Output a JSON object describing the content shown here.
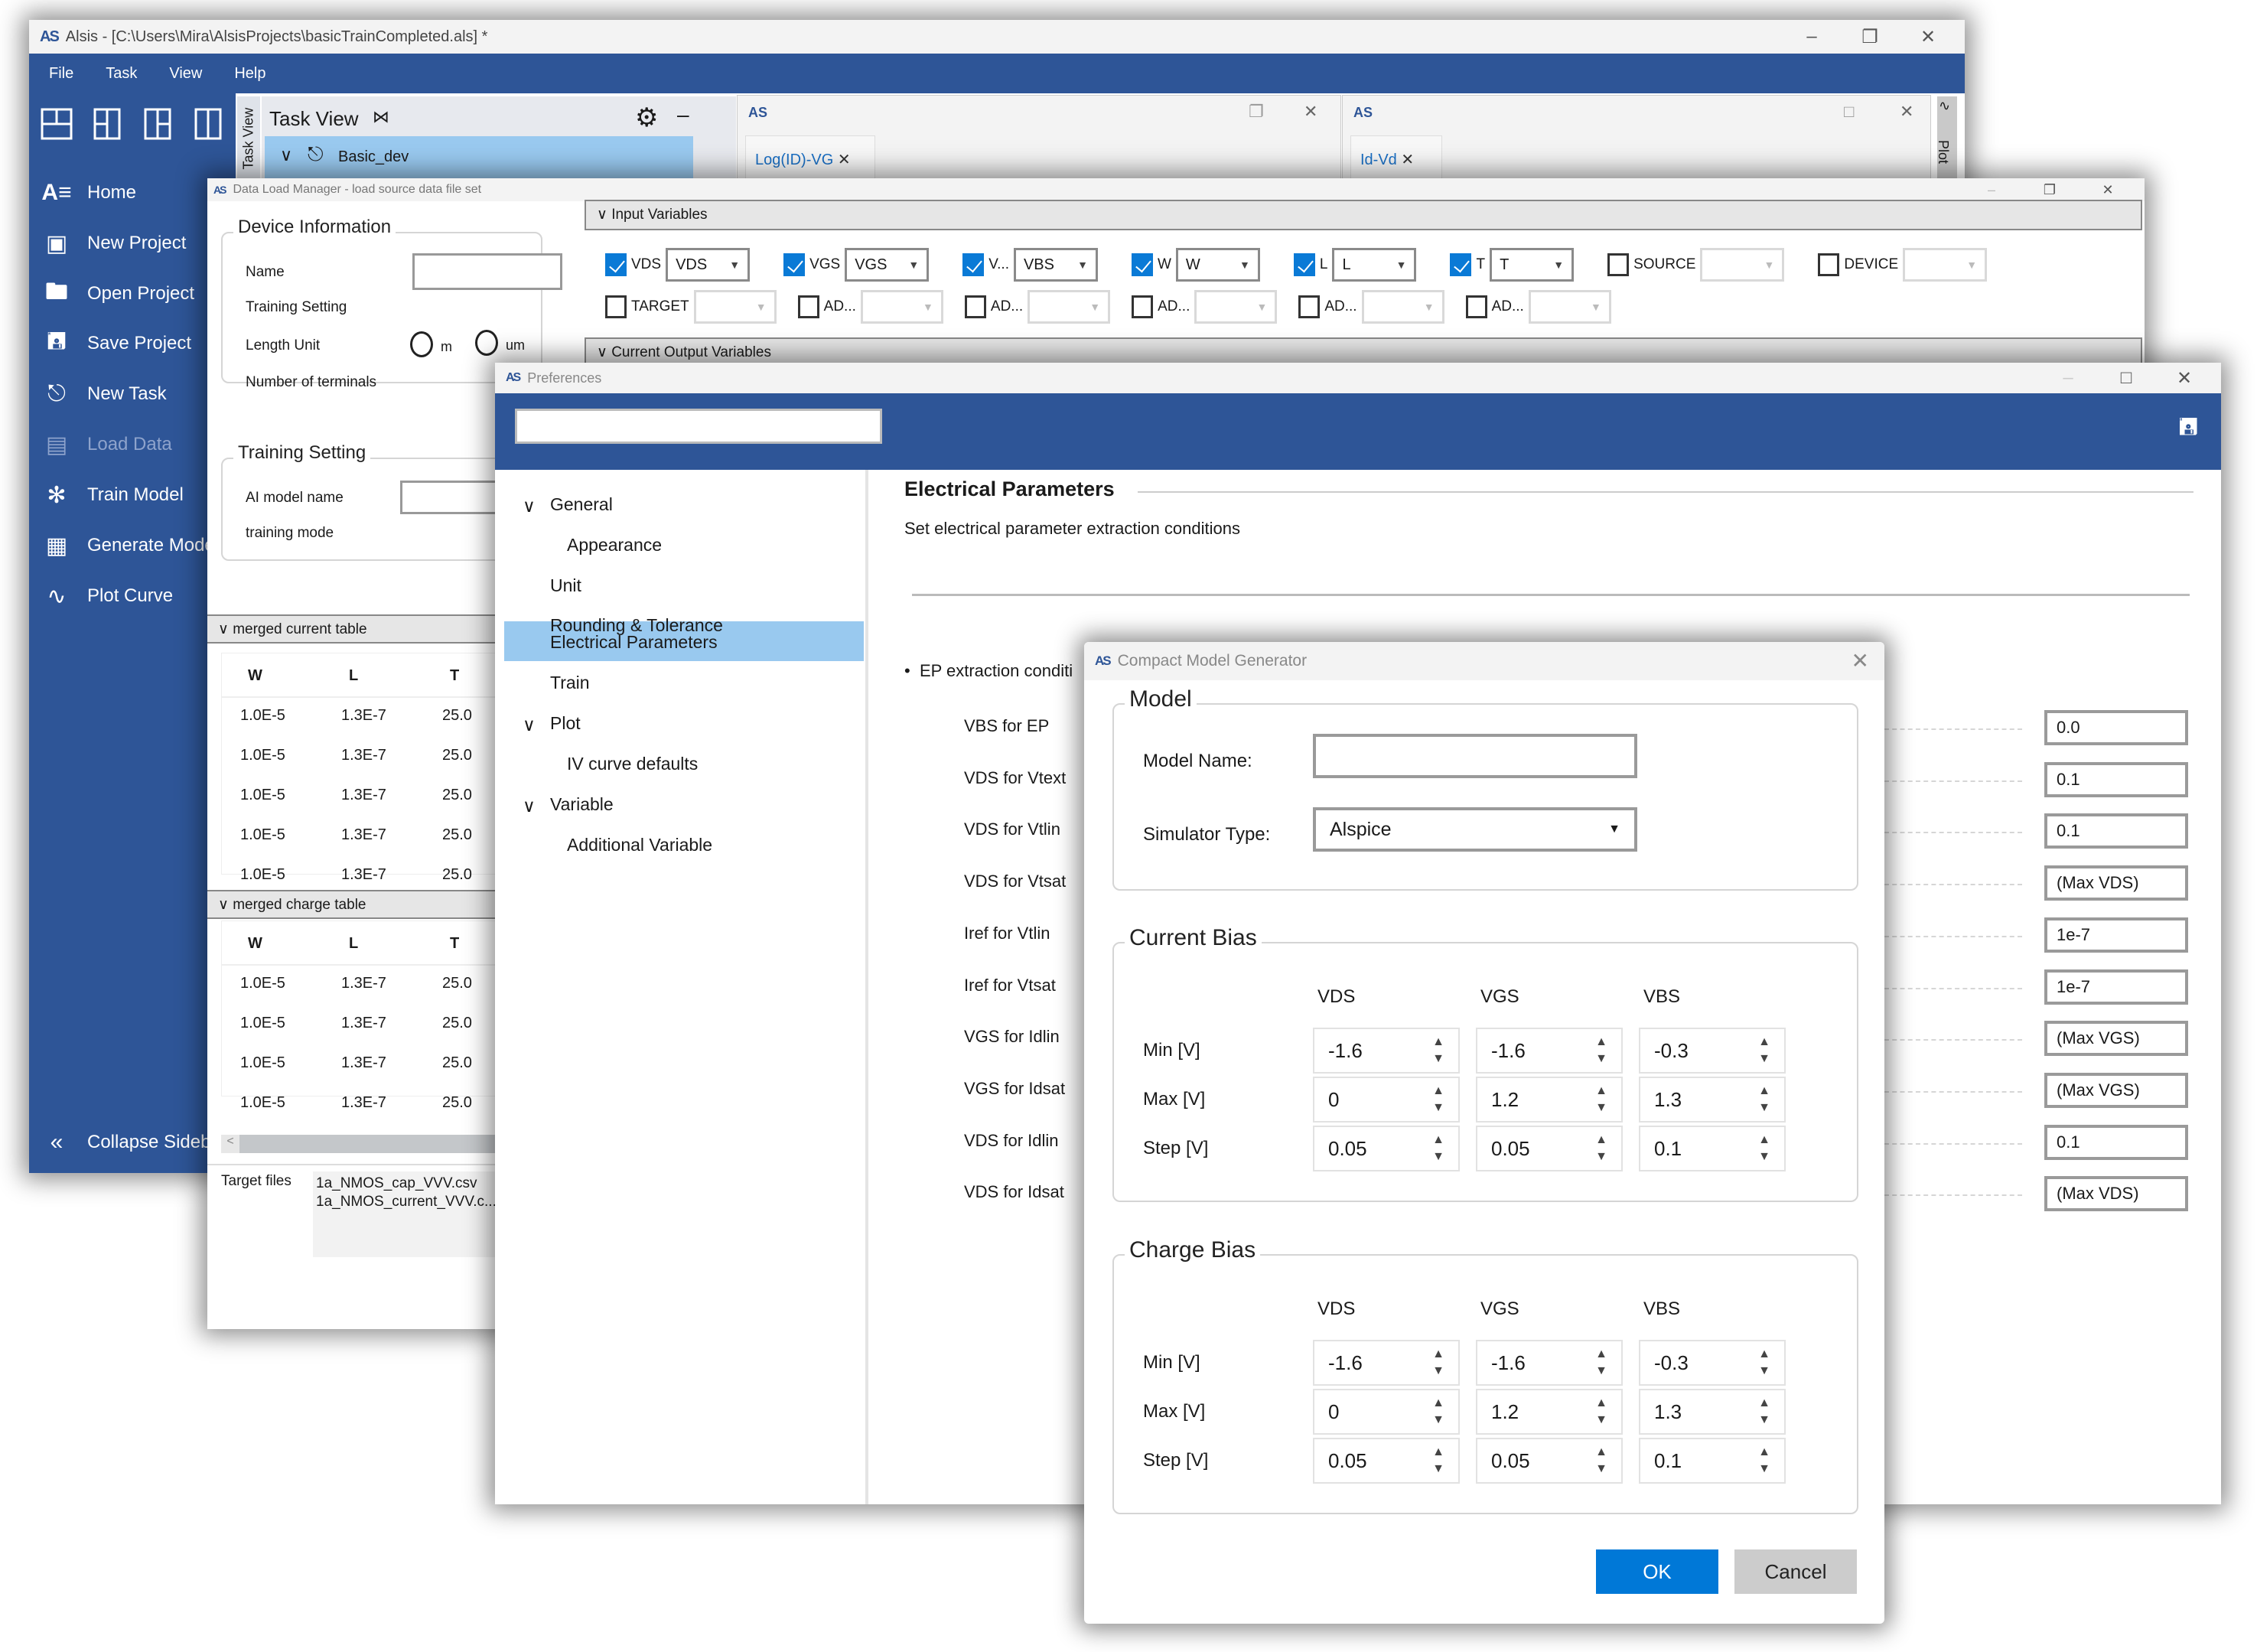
{
  "main_window": {
    "title": "Alsis - [C:\\Users\\Mira\\AlsisProjects\\basicTrainCompleted.als] *",
    "menu": [
      "File",
      "Task",
      "View",
      "Help"
    ],
    "sidebar": {
      "layout_icons": [
        "layout-grid-2x2-icon",
        "layout-split-left-icon",
        "layout-split-right-icon",
        "layout-columns-icon"
      ],
      "items": [
        {
          "label": "Home",
          "icon": "home-logo-icon",
          "enabled": true
        },
        {
          "label": "New Project",
          "icon": "new-project-icon",
          "enabled": true
        },
        {
          "label": "Open Project",
          "icon": "folder-icon",
          "enabled": true
        },
        {
          "label": "Save Project",
          "icon": "save-icon",
          "enabled": true
        },
        {
          "label": "New Task",
          "icon": "task-tree-icon",
          "enabled": true
        },
        {
          "label": "Load Data",
          "icon": "load-data-icon",
          "enabled": false
        },
        {
          "label": "Train Model",
          "icon": "network-icon",
          "enabled": true
        },
        {
          "label": "Generate Model",
          "icon": "chip-icon",
          "enabled": true
        },
        {
          "label": "Plot Curve",
          "icon": "plot-icon",
          "enabled": true
        }
      ],
      "collapse_label": "Collapse Sidebar"
    },
    "task_view": {
      "side_tab": "Task View",
      "title": "Task View",
      "tree_root": "Basic_dev"
    },
    "plot_panels": [
      {
        "tab": "Log(ID)-VG"
      },
      {
        "tab": "Id-Vd"
      }
    ],
    "plot_side_tab": "Plot"
  },
  "data_load_manager": {
    "title": "Data Load Manager - load source data file set",
    "device_information": {
      "legend": "Device Information",
      "name_label": "Name",
      "name_value": "",
      "training_setting_label": "Training Setting",
      "length_unit_label": "Length Unit",
      "length_unit_options": [
        "m",
        "um"
      ],
      "terminals_label": "Number of terminals"
    },
    "training_setting": {
      "legend": "Training Setting",
      "ai_model_label": "AI model name",
      "ai_model_value": "",
      "training_mode_label": "training mode"
    },
    "input_variables": {
      "header": "Input Variables",
      "row1": [
        {
          "label": "VDS",
          "checked": true,
          "value": "VDS"
        },
        {
          "label": "VGS",
          "checked": true,
          "value": "VGS"
        },
        {
          "label": "V...",
          "checked": true,
          "value": "VBS"
        },
        {
          "label": "W",
          "checked": true,
          "value": "W"
        },
        {
          "label": "L",
          "checked": true,
          "value": "L"
        },
        {
          "label": "T",
          "checked": true,
          "value": "T"
        },
        {
          "label": "SOURCE",
          "checked": false,
          "value": ""
        },
        {
          "label": "DEVICE",
          "checked": false,
          "value": ""
        }
      ],
      "row2": [
        {
          "label": "TARGET",
          "checked": false,
          "value": ""
        },
        {
          "label": "AD...",
          "checked": false,
          "value": ""
        },
        {
          "label": "AD...",
          "checked": false,
          "value": ""
        },
        {
          "label": "AD...",
          "checked": false,
          "value": ""
        },
        {
          "label": "AD...",
          "checked": false,
          "value": ""
        },
        {
          "label": "AD...",
          "checked": false,
          "value": ""
        }
      ]
    },
    "current_output_header": "Current Output Variables",
    "merged_current_table": {
      "header": "merged current table",
      "columns": [
        "W",
        "L",
        "T"
      ],
      "rows": [
        [
          "1.0E-5",
          "1.3E-7",
          "25.0"
        ],
        [
          "1.0E-5",
          "1.3E-7",
          "25.0"
        ],
        [
          "1.0E-5",
          "1.3E-7",
          "25.0"
        ],
        [
          "1.0E-5",
          "1.3E-7",
          "25.0"
        ],
        [
          "1.0E-5",
          "1.3E-7",
          "25.0"
        ]
      ]
    },
    "merged_charge_table": {
      "header": "merged charge table",
      "columns": [
        "W",
        "L",
        "T"
      ],
      "rows": [
        [
          "1.0E-5",
          "1.3E-7",
          "25.0"
        ],
        [
          "1.0E-5",
          "1.3E-7",
          "25.0"
        ],
        [
          "1.0E-5",
          "1.3E-7",
          "25.0"
        ],
        [
          "1.0E-5",
          "1.3E-7",
          "25.0"
        ]
      ]
    },
    "target_files_label": "Target files",
    "target_files": [
      "1a_NMOS_cap_VVV.csv",
      "1a_NMOS_current_VVV.c..."
    ]
  },
  "preferences": {
    "title": "Preferences",
    "search_value": "",
    "tree": [
      {
        "label": "General",
        "level": 0,
        "expandable": true
      },
      {
        "label": "Appearance",
        "level": 1
      },
      {
        "label": "Unit",
        "level": 0
      },
      {
        "label": "Rounding & Tolerance",
        "level": 0
      },
      {
        "label": "Electrical Parameters",
        "level": 0,
        "selected": true
      },
      {
        "label": "Train",
        "level": 0
      },
      {
        "label": "Plot",
        "level": 0,
        "expandable": true
      },
      {
        "label": "IV curve defaults",
        "level": 1
      },
      {
        "label": "Variable",
        "level": 0,
        "expandable": true
      },
      {
        "label": "Additional Variable",
        "level": 1
      }
    ],
    "section_title": "Electrical Parameters",
    "section_desc": "Set electrical parameter extraction conditions",
    "bullet": "EP extraction conditi",
    "ep_fields": [
      {
        "label": "VBS for EP",
        "value": "0.0"
      },
      {
        "label": "VDS for Vtext",
        "value": "0.1"
      },
      {
        "label": "VDS for Vtlin",
        "value": "0.1"
      },
      {
        "label": "VDS for Vtsat",
        "value": "(Max VDS)"
      },
      {
        "label": "Iref for Vtlin",
        "value": "1e-7"
      },
      {
        "label": "Iref for Vtsat",
        "value": "1e-7"
      },
      {
        "label": "VGS for Idlin",
        "value": "(Max VGS)"
      },
      {
        "label": "VGS for Idsat",
        "value": "(Max VGS)"
      },
      {
        "label": "VDS for Idlin",
        "value": "0.1"
      },
      {
        "label": "VDS for Idsat",
        "value": "(Max VDS)"
      }
    ]
  },
  "compact_model_generator": {
    "title": "Compact Model Generator",
    "model": {
      "legend": "Model",
      "name_label": "Model Name:",
      "name_value": "",
      "simulator_label": "Simulator Type:",
      "simulator_value": "Alspice"
    },
    "current_bias": {
      "legend": "Current Bias",
      "columns": [
        "VDS",
        "VGS",
        "VBS"
      ],
      "rows": [
        {
          "label": "Min [V]",
          "values": [
            "-1.6",
            "-1.6",
            "-0.3"
          ]
        },
        {
          "label": "Max [V]",
          "values": [
            "0",
            "1.2",
            "1.3"
          ]
        },
        {
          "label": "Step [V]",
          "values": [
            "0.05",
            "0.05",
            "0.1"
          ]
        }
      ]
    },
    "charge_bias": {
      "legend": "Charge Bias",
      "columns": [
        "VDS",
        "VGS",
        "VBS"
      ],
      "rows": [
        {
          "label": "Min [V]",
          "values": [
            "-1.6",
            "-1.6",
            "-0.3"
          ]
        },
        {
          "label": "Max [V]",
          "values": [
            "0",
            "1.2",
            "1.3"
          ]
        },
        {
          "label": "Step [V]",
          "values": [
            "0.05",
            "0.05",
            "0.1"
          ]
        }
      ]
    },
    "ok_label": "OK",
    "cancel_label": "Cancel"
  },
  "colors": {
    "brand_blue": "#2e5597",
    "selection_blue": "#99c9ef",
    "primary_button": "#0078d7",
    "secondary_button": "#cccccc",
    "tab_text_blue": "#1a6fc4"
  }
}
